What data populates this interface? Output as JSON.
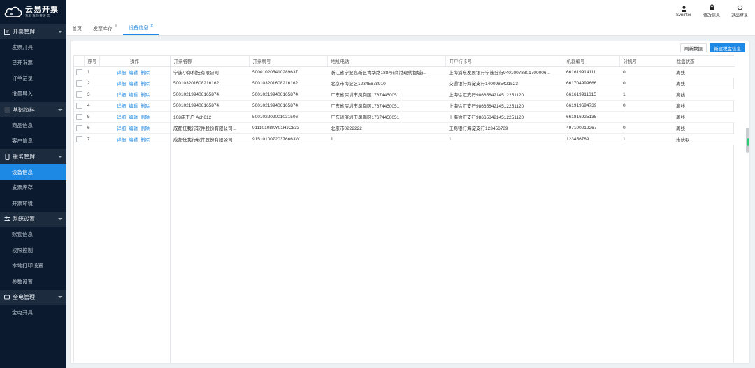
{
  "logo": {
    "title": "云易开票",
    "subtitle": "我有我的开发票"
  },
  "sidebar": {
    "groups": [
      {
        "icon": "invoice-icon",
        "title": "开票管理",
        "items": [
          {
            "label": "发票开具",
            "active": false
          },
          {
            "label": "已开发票",
            "active": false
          },
          {
            "label": "订单记录",
            "active": false
          },
          {
            "label": "批量导入",
            "active": false
          }
        ]
      },
      {
        "icon": "list-icon",
        "title": "基础资料",
        "items": [
          {
            "label": "商品信息",
            "active": false
          },
          {
            "label": "客户信息",
            "active": false
          }
        ]
      },
      {
        "icon": "device-icon",
        "title": "税务管理",
        "items": [
          {
            "label": "设备信息",
            "active": true
          },
          {
            "label": "发票库存",
            "active": false
          },
          {
            "label": "开票环境",
            "active": false
          }
        ]
      },
      {
        "icon": "settings-icon",
        "title": "系统设置",
        "items": [
          {
            "label": "账套信息",
            "active": false
          },
          {
            "label": "权限控制",
            "active": false
          },
          {
            "label": "本地打印设置",
            "active": false
          },
          {
            "label": "参数设置",
            "active": false
          }
        ]
      },
      {
        "icon": "power-icon",
        "title": "全电管理",
        "items": [
          {
            "label": "全电开具",
            "active": false
          }
        ]
      }
    ]
  },
  "topbar": {
    "user_label": "Svninter",
    "modify_label": "修改信息",
    "logout_label": "退出登录"
  },
  "tabs": [
    {
      "label": "首页",
      "closable": false,
      "active": false
    },
    {
      "label": "发票库存",
      "closable": true,
      "active": false
    },
    {
      "label": "设备信息",
      "closable": true,
      "active": true
    }
  ],
  "toolbar": {
    "refresh_label": "刷新数据",
    "new_label": "新建税盘信息"
  },
  "table": {
    "columns": [
      "序号",
      "操作",
      "开票名称",
      "开票税号",
      "地址电话",
      "开户行卡号",
      "机器编号",
      "分机号",
      "税盘状态"
    ],
    "actions": [
      "详细",
      "编辑",
      "删除"
    ],
    "rows": [
      [
        "1",
        "宁波小郎科技有限公司",
        "500010205410289637",
        "浙江省宁波高新区青华路188号(商港现代都城)...",
        "上海浦东发展银行宁波分行94010078801700006...",
        "661619914111",
        "0",
        "离线"
      ],
      [
        "2",
        "500103201608216162",
        "500103201608216162",
        "北京市海淀区12345678910",
        "交通银行海淀支行1400985421523",
        "661704999666",
        "0",
        "离线"
      ],
      [
        "3",
        "500102199406165874",
        "500102199406165874",
        "广东省深圳市凤岗区17674450051",
        "上海徐汇支行98665842145122511​20",
        "661619911615",
        "1",
        "离线"
      ],
      [
        "4",
        "500102199406165874",
        "500102199406165874",
        "广东省深圳市凤岗区17674450051",
        "上海徐汇支行9866584214512251120",
        "661919694739",
        "0",
        "离线"
      ],
      [
        "5",
        "108床下户 Ach612",
        "500102202001031506",
        "广东省深圳市凤岗区17674450051",
        "上海徐汇支行9866584214512251120",
        "661816925135",
        "",
        "离线"
      ],
      [
        "6",
        "成都任我行软件股份有限公司...",
        "91110108KY01HJC833",
        "北京市0222222",
        "工商银行海淀支行123456789",
        "497100012267",
        "0",
        "离线"
      ],
      [
        "7",
        "成都任我行软件股份有限公司",
        "91510100720376663W",
        "1",
        "1",
        "123456789",
        "1",
        "未获取"
      ]
    ]
  }
}
